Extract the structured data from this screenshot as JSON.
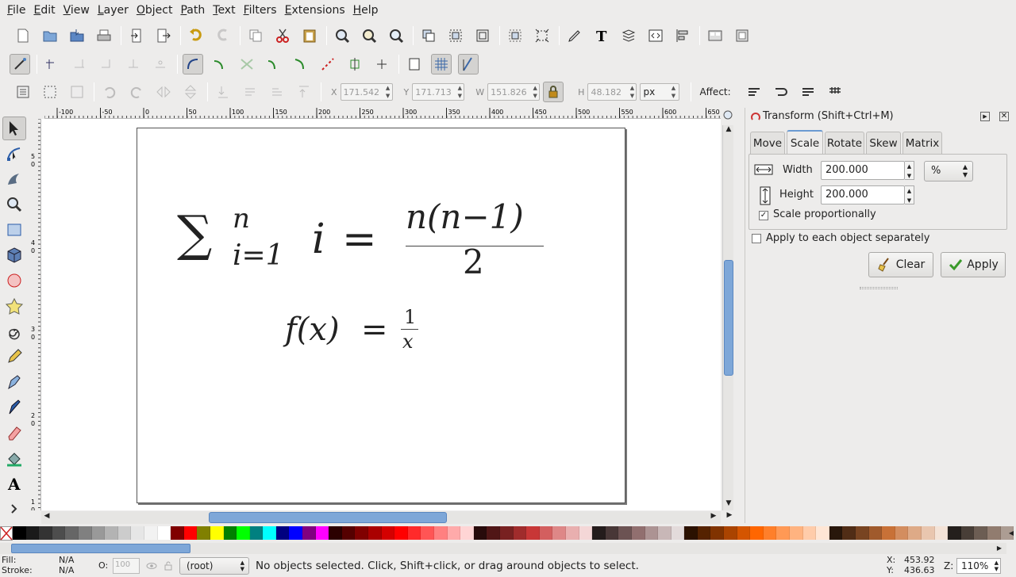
{
  "menu": [
    "File",
    "Edit",
    "View",
    "Layer",
    "Object",
    "Path",
    "Text",
    "Filters",
    "Extensions",
    "Help"
  ],
  "geometry": {
    "x_label": "X",
    "x_value": "171.542",
    "y_label": "Y",
    "y_value": "171.713",
    "w_label": "W",
    "w_value": "151.826",
    "h_label": "H",
    "h_value": "48.182",
    "unit": "px",
    "affect_label": "Affect:"
  },
  "ruler_h_labels": [
    "-100",
    "-50",
    "0",
    "50",
    "100",
    "150",
    "200",
    "250",
    "300",
    "350",
    "400",
    "450",
    "500",
    "550",
    "600",
    "650"
  ],
  "ruler_v_labels": [
    "5",
    "4",
    "3",
    "2",
    "1"
  ],
  "canvas": {
    "formula1": {
      "sum": "∑",
      "upper": "n",
      "lower": "i=1",
      "var": "i",
      "eq": "=",
      "num": "n(n−1)",
      "den": "2"
    },
    "formula2": {
      "lhs": "f(x)",
      "eq": "=",
      "num": "1",
      "den": "x"
    }
  },
  "dialog": {
    "title": "Transform (Shift+Ctrl+M)",
    "tabs": [
      "Move",
      "Scale",
      "Rotate",
      "Skew",
      "Matrix"
    ],
    "active_tab": "Scale",
    "width_label": "Width",
    "width_value": "200.000",
    "unit": "%",
    "height_label": "Height",
    "height_value": "200.000",
    "scale_prop_label": "Scale proportionally",
    "scale_prop_checked": true,
    "apply_each_label": "Apply to each object separately",
    "apply_each_checked": false,
    "clear_label": "Clear",
    "apply_label": "Apply"
  },
  "palette_colors": [
    "#000000",
    "#1a1a1a",
    "#333333",
    "#4d4d4d",
    "#666666",
    "#808080",
    "#999999",
    "#b3b3b3",
    "#cccccc",
    "#e6e6e6",
    "#f2f2f2",
    "#ffffff",
    "#800000",
    "#ff0000",
    "#808000",
    "#ffff00",
    "#008000",
    "#00ff00",
    "#008080",
    "#00ffff",
    "#000080",
    "#0000ff",
    "#800080",
    "#ff00ff",
    "#2b0000",
    "#550000",
    "#800000",
    "#aa0000",
    "#d40000",
    "#ff0000",
    "#ff2a2a",
    "#ff5555",
    "#ff8080",
    "#ffaaaa",
    "#ffd5d5",
    "#280b0b",
    "#501616",
    "#782121",
    "#a02c2c",
    "#c83737",
    "#d35f5f",
    "#de8787",
    "#e9afaf",
    "#f4d7d7",
    "#241c1c",
    "#483737",
    "#6c5353",
    "#916f6f",
    "#ac9393",
    "#c8b7b7",
    "#e3dbdb",
    "#2b1100",
    "#552200",
    "#803300",
    "#aa4400",
    "#d45500",
    "#ff6600",
    "#ff7f2a",
    "#ff9955",
    "#ffb380",
    "#ffccaa",
    "#ffe6d5",
    "#28170b",
    "#502d16",
    "#784421",
    "#a05a2c",
    "#c87137",
    "#d38d5f",
    "#deaa87",
    "#e9c6af",
    "#f4e3d7",
    "#241f1c",
    "#483e37",
    "#6c5d53",
    "#917c6f",
    "#ac9d93"
  ],
  "status": {
    "fill_label": "Fill:",
    "fill_value": "N/A",
    "stroke_label": "Stroke:",
    "stroke_value": "N/A",
    "opacity_label": "O:",
    "opacity_value": "100",
    "layer": "(root)",
    "message": "No objects selected. Click, Shift+click, or drag around objects to select.",
    "x_label": "X:",
    "x_coord": "453.92",
    "y_label": "Y:",
    "y_coord": "436.63",
    "zoom_label": "Z:",
    "zoom": "110%"
  }
}
